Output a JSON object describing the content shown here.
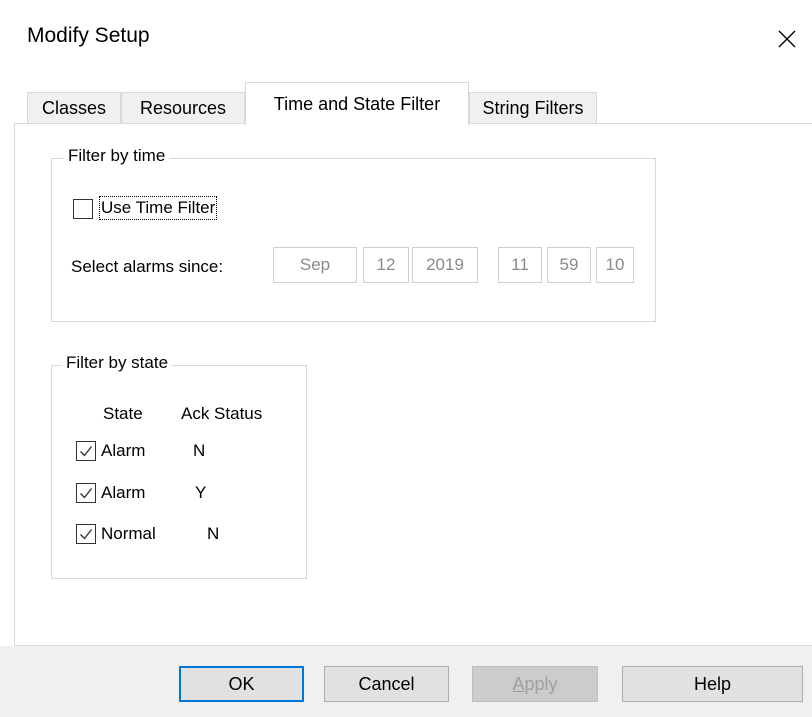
{
  "window": {
    "title": "Modify Setup"
  },
  "tabs": [
    {
      "label": "Classes"
    },
    {
      "label": "Resources"
    },
    {
      "label": "Time and State Filter",
      "active": true
    },
    {
      "label": "String Filters"
    }
  ],
  "time_filter": {
    "legend": "Filter by time",
    "use_label": "Use Time Filter",
    "use_checked": false,
    "since_label": "Select alarms since:",
    "month": "Sep",
    "day": "12",
    "year": "2019",
    "hour": "11",
    "minute": "59",
    "second": "10"
  },
  "state_filter": {
    "legend": "Filter by state",
    "col_state": "State",
    "col_ack": "Ack Status",
    "rows": [
      {
        "state": "Alarm",
        "ack": "N",
        "checked": true
      },
      {
        "state": "Alarm",
        "ack": "Y",
        "checked": true
      },
      {
        "state": "Normal",
        "ack": "N",
        "checked": true
      }
    ]
  },
  "buttons": {
    "ok": "OK",
    "cancel": "Cancel",
    "apply_first": "A",
    "apply_rest": "pply",
    "help": "Help"
  },
  "colors": {
    "accent": "#0078d7",
    "border": "#d9d9d9",
    "disabled_text": "#8a8a8a"
  }
}
